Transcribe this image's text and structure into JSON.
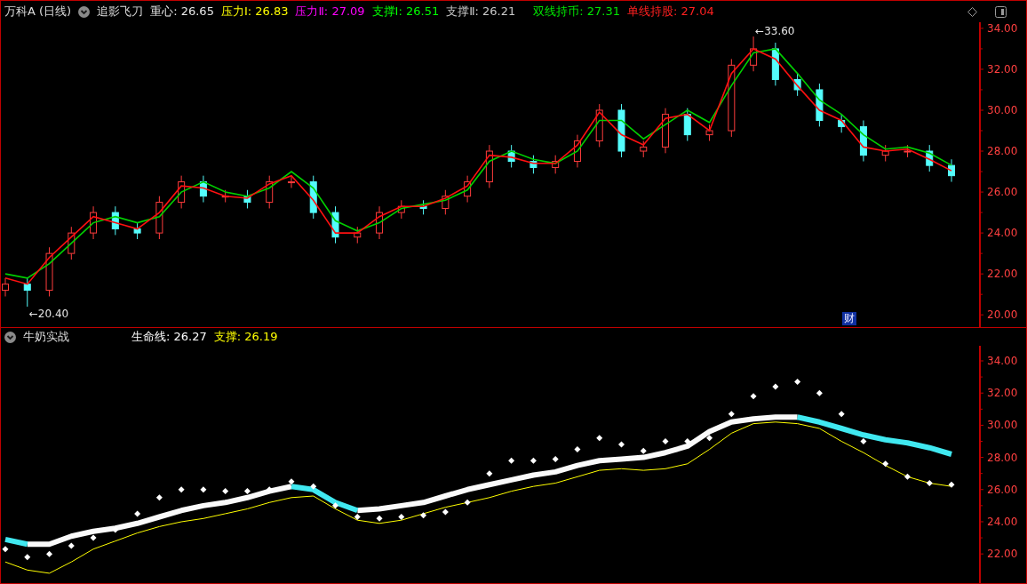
{
  "price_pane": {
    "title": "万科A (日线)",
    "indicator": "追影飞刀",
    "readouts": [
      {
        "text": "重心: 26.65",
        "color": "#e6e6e6"
      },
      {
        "text": "压力Ⅰ: 26.83",
        "color": "#ffff00"
      },
      {
        "text": "压力Ⅱ: 27.09",
        "color": "#ff00ff"
      },
      {
        "text": "支撑Ⅰ: 26.51",
        "color": "#00ff00"
      },
      {
        "text": "支撑Ⅱ: 26.21",
        "color": "#c8c8c8"
      },
      {
        "text": "双线持币: 27.31",
        "color": "#00e600"
      },
      {
        "text": "单线持股: 27.04",
        "color": "#ff2020"
      }
    ],
    "badge": "财",
    "chart_data": {
      "type": "candlestick",
      "ylim": [
        19.4,
        34.3
      ],
      "yticks": [
        {
          "value": 20,
          "label": "20.00"
        },
        {
          "value": 22,
          "label": "22.00"
        },
        {
          "value": 24,
          "label": "24.00"
        },
        {
          "value": 26,
          "label": "26.00"
        },
        {
          "value": 28,
          "label": "28.00"
        },
        {
          "value": 30,
          "label": "30.00"
        },
        {
          "value": 32,
          "label": "32.00"
        },
        {
          "value": 34,
          "label": "34.00"
        }
      ],
      "ohlc": [
        [
          21.2,
          21.8,
          20.9,
          21.5
        ],
        [
          21.5,
          21.8,
          20.4,
          21.2
        ],
        [
          21.2,
          23.3,
          20.9,
          23
        ],
        [
          23,
          24.3,
          22.7,
          24
        ],
        [
          24,
          25.3,
          23.7,
          25
        ],
        [
          25,
          25.3,
          23.9,
          24.2
        ],
        [
          24.2,
          24.5,
          23.7,
          24
        ],
        [
          24,
          25.8,
          23.7,
          25.5
        ],
        [
          25.5,
          26.8,
          25.2,
          26.5
        ],
        [
          26.5,
          26.8,
          25.5,
          25.8
        ],
        [
          25.8,
          26.1,
          25.5,
          25.8
        ],
        [
          25.8,
          26.1,
          25.2,
          25.5
        ],
        [
          25.5,
          26.8,
          25.2,
          26.5
        ],
        [
          26.5,
          26.8,
          26.2,
          26.5
        ],
        [
          26.5,
          26.8,
          24.7,
          25
        ],
        [
          25,
          25.3,
          23.5,
          23.8
        ],
        [
          23.8,
          24.3,
          23.5,
          24
        ],
        [
          24,
          25.3,
          23.7,
          25
        ],
        [
          25,
          25.6,
          24.7,
          25.3
        ],
        [
          25.3,
          25.6,
          24.9,
          25.2
        ],
        [
          25.2,
          26.1,
          24.9,
          25.8
        ],
        [
          25.8,
          26.8,
          25.5,
          26.5
        ],
        [
          26.5,
          28.3,
          26.2,
          28
        ],
        [
          28,
          28.3,
          27.2,
          27.5
        ],
        [
          27.5,
          27.8,
          26.9,
          27.2
        ],
        [
          27.2,
          27.8,
          26.9,
          27.5
        ],
        [
          27.5,
          28.8,
          27.2,
          28.5
        ],
        [
          28.5,
          30.3,
          28.2,
          30
        ],
        [
          30,
          30.3,
          27.7,
          28
        ],
        [
          28,
          28.5,
          27.7,
          28.2
        ],
        [
          28.2,
          30.1,
          27.9,
          29.8
        ],
        [
          29.8,
          30.1,
          28.5,
          28.8
        ],
        [
          28.8,
          29.3,
          28.5,
          29
        ],
        [
          29,
          32.5,
          28.7,
          32.2
        ],
        [
          32.2,
          33.6,
          31.9,
          33
        ],
        [
          33,
          33.3,
          31.2,
          31.5
        ],
        [
          31.5,
          31.8,
          30.7,
          31
        ],
        [
          31,
          31.3,
          29.2,
          29.5
        ],
        [
          29.5,
          29.8,
          28.9,
          29.2
        ],
        [
          29.2,
          29.5,
          27.5,
          27.8
        ],
        [
          27.8,
          28.3,
          27.5,
          28
        ],
        [
          28,
          28.3,
          27.7,
          28
        ],
        [
          28,
          28.3,
          27,
          27.3
        ],
        [
          27.3,
          27.6,
          26.5,
          26.8
        ]
      ],
      "series": [
        {
          "type": "line",
          "color": "#00d000",
          "values": [
            22,
            21.8,
            22.5,
            23.5,
            24.5,
            24.8,
            24.5,
            24.8,
            26,
            26.5,
            26,
            25.8,
            26.2,
            27,
            26.2,
            24.6,
            24.1,
            24.5,
            25.2,
            25.4,
            25.6,
            26.1,
            27.5,
            28,
            27.6,
            27.4,
            28,
            29.5,
            29.5,
            28.6,
            29.3,
            30,
            29.4,
            31.2,
            32.8,
            33,
            31.8,
            30.5,
            29.8,
            28.8,
            28.1,
            28.2,
            27.9,
            27.31
          ]
        },
        {
          "type": "line",
          "color": "#ff1010",
          "values": [
            21.8,
            21.5,
            22.8,
            23.8,
            24.8,
            24.5,
            24.2,
            25,
            26.3,
            26.2,
            25.8,
            25.7,
            26.4,
            26.8,
            25.6,
            24,
            24,
            24.8,
            25.3,
            25.3,
            25.7,
            26.3,
            27.8,
            27.7,
            27.4,
            27.4,
            28.3,
            29.9,
            28.8,
            28.3,
            29.6,
            29.8,
            29,
            31.8,
            33,
            32.5,
            31.2,
            30,
            29.5,
            28.2,
            28,
            28.1,
            27.6,
            27.04
          ]
        }
      ],
      "annotations": [
        {
          "text": "←33.60"
        },
        {
          "text": "←20.40"
        }
      ]
    }
  },
  "study_pane": {
    "title": "牛奶实战",
    "readouts": [
      {
        "text": "生命线: 26.27",
        "color": "#ffffff"
      },
      {
        "text": "支撑: 26.19",
        "color": "#ffff00"
      }
    ],
    "chart_data": {
      "type": "line",
      "ylim": [
        20.13,
        34.94
      ],
      "yticks": [
        {
          "value": 22,
          "label": "22.00"
        },
        {
          "value": 24,
          "label": "24.00"
        },
        {
          "value": 26,
          "label": "26.00"
        },
        {
          "value": 28,
          "label": "28.00"
        },
        {
          "value": 30,
          "label": "30.00"
        },
        {
          "value": 32,
          "label": "32.00"
        },
        {
          "value": 34,
          "label": "34.00"
        }
      ],
      "series": [
        {
          "type": "scatter",
          "color": "#ffffff",
          "marker": "diamond",
          "values": [
            22.3,
            21.8,
            22,
            22.5,
            23,
            23.5,
            24.5,
            25.5,
            26,
            26,
            25.9,
            25.9,
            26,
            26.5,
            26.2,
            25,
            24.3,
            24.2,
            24.3,
            24.4,
            24.6,
            25.2,
            27,
            27.8,
            27.8,
            27.9,
            28.5,
            29.2,
            28.8,
            28.4,
            29,
            29,
            29.2,
            30.7,
            31.8,
            32.4,
            32.7,
            32,
            30.7,
            29,
            27.6,
            26.8,
            26.4,
            26.3
          ]
        },
        {
          "color": "#ffff00",
          "values": [
            21.5,
            21,
            20.8,
            21.5,
            22.3,
            22.8,
            23.3,
            23.7,
            24,
            24.2,
            24.5,
            24.8,
            25.2,
            25.5,
            25.6,
            24.8,
            24.1,
            23.9,
            24.1,
            24.5,
            24.9,
            25.2,
            25.5,
            25.9,
            26.2,
            26.4,
            26.8,
            27.2,
            27.3,
            27.2,
            27.3,
            27.6,
            28.5,
            29.5,
            30.1,
            30.2,
            30.1,
            29.8,
            29,
            28.3,
            27.5,
            26.8,
            26.4,
            26.2
          ]
        },
        {
          "color": "#fafafa",
          "values": [
            null,
            22.6,
            22.6,
            23.1,
            23.4,
            23.6,
            23.9,
            24.3,
            24.7,
            25,
            25.2,
            25.5,
            25.9,
            26.2,
            null,
            null,
            24.7,
            24.8,
            25,
            25.2,
            25.6,
            26,
            26.3,
            26.6,
            26.9,
            27.1,
            27.5,
            27.8,
            27.9,
            28,
            28.3,
            28.7,
            29.6,
            30.2,
            30.4,
            30.5,
            30.5,
            null,
            null,
            null,
            null,
            null,
            null,
            null
          ]
        },
        {
          "color": "#40e8f0",
          "values": [
            22.9,
            22.6,
            null,
            null,
            null,
            null,
            null,
            null,
            null,
            null,
            null,
            null,
            null,
            26.2,
            26,
            25.2,
            24.7,
            null,
            null,
            null,
            null,
            null,
            null,
            null,
            null,
            null,
            null,
            null,
            null,
            null,
            null,
            null,
            null,
            null,
            null,
            null,
            30.5,
            30.2,
            29.8,
            29.4,
            29.1,
            28.9,
            28.6,
            28.2
          ]
        }
      ]
    }
  }
}
